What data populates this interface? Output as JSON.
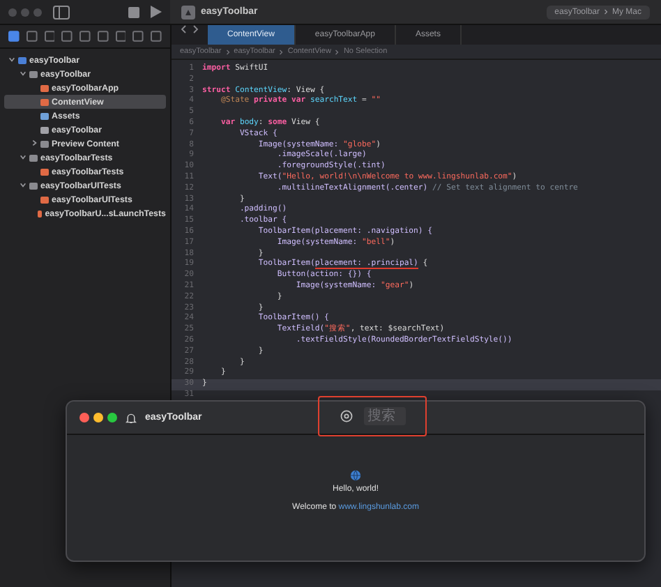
{
  "toolbar": {
    "app_title": "easyToolbar",
    "scheme": "easyToolbar",
    "destination": "My Mac"
  },
  "navigator": {
    "tree": [
      {
        "label": "easyToolbar",
        "kind": "project",
        "expanded": true,
        "selected": false,
        "children": [
          {
            "label": "easyToolbar",
            "kind": "folder",
            "expanded": true,
            "selected": false,
            "children": [
              {
                "label": "easyToolbarApp",
                "kind": "swift",
                "selected": false
              },
              {
                "label": "ContentView",
                "kind": "swift",
                "selected": true
              },
              {
                "label": "Assets",
                "kind": "assets",
                "selected": false
              },
              {
                "label": "easyToolbar",
                "kind": "file",
                "selected": false
              },
              {
                "label": "Preview Content",
                "kind": "folder",
                "expanded": false,
                "selected": false
              }
            ]
          },
          {
            "label": "easyToolbarTests",
            "kind": "folder",
            "expanded": true,
            "selected": false,
            "children": [
              {
                "label": "easyToolbarTests",
                "kind": "swift",
                "selected": false
              }
            ]
          },
          {
            "label": "easyToolbarUITests",
            "kind": "folder",
            "expanded": true,
            "selected": false,
            "children": [
              {
                "label": "easyToolbarUITests",
                "kind": "swift",
                "selected": false
              },
              {
                "label": "easyToolbarU...sLaunchTests",
                "kind": "swift",
                "selected": false
              }
            ]
          }
        ]
      }
    ]
  },
  "editor": {
    "tabs": [
      {
        "label": "ContentView",
        "selected": true
      },
      {
        "label": "easyToolbarApp",
        "selected": false
      },
      {
        "label": "Assets",
        "selected": false
      }
    ],
    "breadcrumb": [
      "easyToolbar",
      "easyToolbar",
      "ContentView",
      "No Selection"
    ],
    "lines": [
      {
        "number": "1",
        "current": false,
        "tokens": [
          {
            "text": "import",
            "kind": "kw"
          },
          {
            "text": " SwiftUI",
            "kind": "plain"
          }
        ]
      },
      {
        "number": "2",
        "current": false
      },
      {
        "number": "3",
        "current": false,
        "tokens": [
          {
            "text": "struct",
            "kind": "kw"
          },
          {
            "text": " ContentView",
            "kind": "decl"
          },
          {
            "text": ": View {",
            "kind": "plain"
          }
        ]
      },
      {
        "number": "4",
        "current": false,
        "tokens": [
          {
            "text": "    @State",
            "kind": "attr"
          },
          {
            "text": " private var",
            "kind": "kw"
          },
          {
            "text": " searchText",
            "kind": "decl"
          },
          {
            "text": " = ",
            "kind": "plain"
          },
          {
            "text": "\"\"",
            "kind": "str"
          }
        ]
      },
      {
        "number": "5",
        "current": false
      },
      {
        "number": "6",
        "current": false,
        "tokens": [
          {
            "text": "    var",
            "kind": "kw"
          },
          {
            "text": " body",
            "kind": "decl"
          },
          {
            "text": ": ",
            "kind": "plain"
          },
          {
            "text": "some",
            "kind": "kw"
          },
          {
            "text": " View {",
            "kind": "plain"
          }
        ]
      },
      {
        "number": "7",
        "current": false,
        "tokens": [
          {
            "text": "        VStack {",
            "kind": "type"
          }
        ]
      },
      {
        "number": "8",
        "current": false,
        "tokens": [
          {
            "text": "            Image(systemName: ",
            "kind": "type"
          },
          {
            "text": "\"globe\"",
            "kind": "str"
          },
          {
            "text": ")",
            "kind": "plain"
          }
        ]
      },
      {
        "number": "9",
        "current": false,
        "tokens": [
          {
            "text": "                .imageScale(.large)",
            "kind": "type"
          }
        ]
      },
      {
        "number": "10",
        "current": false,
        "tokens": [
          {
            "text": "                .foregroundStyle(.tint)",
            "kind": "type"
          }
        ]
      },
      {
        "number": "11",
        "current": false,
        "tokens": [
          {
            "text": "            Text(",
            "kind": "type"
          },
          {
            "text": "\"Hello, world!\\n\\nWelcome to www.lingshunlab.com\"",
            "kind": "str"
          },
          {
            "text": ")",
            "kind": "plain"
          }
        ]
      },
      {
        "number": "12",
        "current": false,
        "tokens": [
          {
            "text": "                .multilineTextAlignment(.center)",
            "kind": "type"
          },
          {
            "text": " // Set text alignment to centre",
            "kind": "comment"
          }
        ]
      },
      {
        "number": "13",
        "current": false,
        "tokens": [
          {
            "text": "        }",
            "kind": "plain"
          }
        ]
      },
      {
        "number": "14",
        "current": false,
        "tokens": [
          {
            "text": "        .padding()",
            "kind": "type"
          }
        ]
      },
      {
        "number": "15",
        "current": false,
        "tokens": [
          {
            "text": "        .toolbar {",
            "kind": "type"
          }
        ]
      },
      {
        "number": "16",
        "current": false,
        "tokens": [
          {
            "text": "            ToolbarItem(placement: .navigation) {",
            "kind": "type"
          }
        ]
      },
      {
        "number": "17",
        "current": false,
        "tokens": [
          {
            "text": "                Image(systemName: ",
            "kind": "type"
          },
          {
            "text": "\"bell\"",
            "kind": "str"
          },
          {
            "text": ")",
            "kind": "plain"
          }
        ]
      },
      {
        "number": "18",
        "current": false,
        "tokens": [
          {
            "text": "            }",
            "kind": "plain"
          }
        ]
      },
      {
        "number": "19",
        "current": false,
        "tokens": [
          {
            "text": "            ToolbarItem(",
            "kind": "type"
          },
          {
            "text": "placement: .principal)",
            "kind": "marked"
          },
          {
            "text": " {",
            "kind": "plain"
          }
        ]
      },
      {
        "number": "20",
        "current": false,
        "tokens": [
          {
            "text": "                Button(action: {}) {",
            "kind": "type"
          }
        ]
      },
      {
        "number": "21",
        "current": false,
        "tokens": [
          {
            "text": "                    Image(systemName: ",
            "kind": "type"
          },
          {
            "text": "\"gear\"",
            "kind": "str"
          },
          {
            "text": ")",
            "kind": "plain"
          }
        ]
      },
      {
        "number": "22",
        "current": false,
        "tokens": [
          {
            "text": "                }",
            "kind": "plain"
          }
        ]
      },
      {
        "number": "23",
        "current": false,
        "tokens": [
          {
            "text": "            }",
            "kind": "plain"
          }
        ]
      },
      {
        "number": "24",
        "current": false,
        "tokens": [
          {
            "text": "            ToolbarItem() {",
            "kind": "type"
          }
        ]
      },
      {
        "number": "25",
        "current": false,
        "tokens": [
          {
            "text": "                TextField(",
            "kind": "type"
          },
          {
            "text": "\"搜索\"",
            "kind": "str"
          },
          {
            "text": ", text: $searchText)",
            "kind": "plain"
          }
        ]
      },
      {
        "number": "26",
        "current": false,
        "tokens": [
          {
            "text": "                    .textFieldStyle(RoundedBorderTextFieldStyle())",
            "kind": "type"
          }
        ]
      },
      {
        "number": "27",
        "current": false,
        "tokens": [
          {
            "text": "            }",
            "kind": "plain"
          }
        ]
      },
      {
        "number": "28",
        "current": false,
        "tokens": [
          {
            "text": "        }",
            "kind": "plain"
          }
        ]
      },
      {
        "number": "29",
        "current": false,
        "tokens": [
          {
            "text": "    }",
            "kind": "plain"
          }
        ]
      },
      {
        "number": "30",
        "current": true,
        "tokens": [
          {
            "text": "}",
            "kind": "plain"
          }
        ]
      },
      {
        "number": "31",
        "current": false
      }
    ]
  },
  "preview_window": {
    "title": "easyToolbar",
    "search": {
      "placeholder": "搜索"
    },
    "hello": "Hello, world!",
    "welcome": "Welcome to ",
    "link": "www.lingshunlab.com"
  }
}
